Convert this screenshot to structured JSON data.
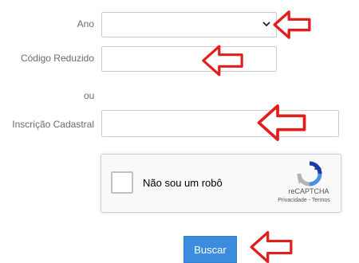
{
  "form": {
    "ano_label": "Ano",
    "ano_value": "",
    "codigo_label": "Código Reduzido",
    "codigo_value": "",
    "ou_label": "ou",
    "inscricao_label": "Inscrição Cadastral",
    "inscricao_value": ""
  },
  "recaptcha": {
    "checkbox_label": "Não sou um robô",
    "brand": "reCAPTCHA",
    "links": "Privacidade - Termos"
  },
  "submit": {
    "label": "Buscar"
  },
  "colors": {
    "arrow": "#e01e1e",
    "button": "#3c8dde",
    "border": "#cccccc"
  },
  "icons": [
    "chevron-down-icon",
    "recaptcha-logo-icon",
    "arrow-left-icon"
  ]
}
